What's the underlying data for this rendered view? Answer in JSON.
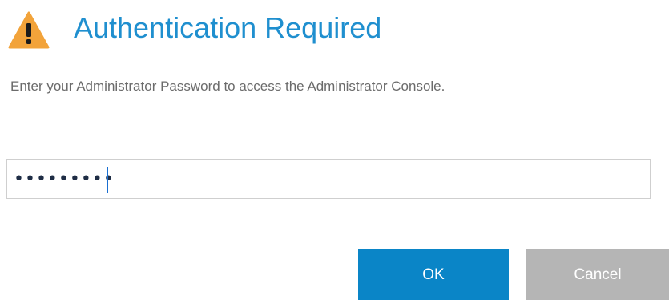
{
  "dialog": {
    "title": "Authentication Required",
    "message": "Enter your Administrator Password to access the Administrator Console.",
    "icon": "warning-icon"
  },
  "password": {
    "value": "•••••••••"
  },
  "buttons": {
    "ok_label": "OK",
    "cancel_label": "Cancel"
  },
  "colors": {
    "title": "#1f8fcf",
    "warning": "#f2a33a",
    "ok_background": "#0a85c7",
    "cancel_background": "#b5b5b5"
  }
}
